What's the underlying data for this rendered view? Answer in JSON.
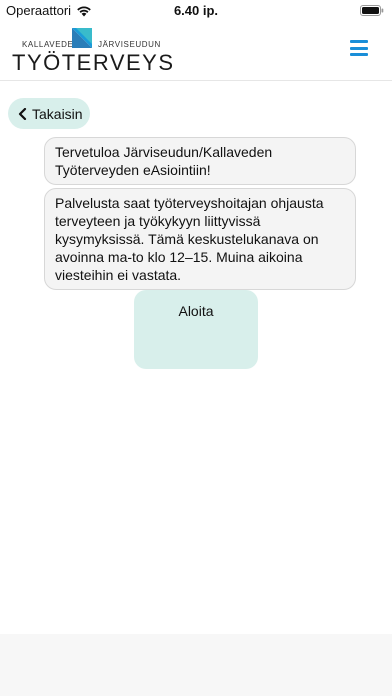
{
  "status_bar": {
    "carrier": "Operaattori",
    "time": "6.40 ip."
  },
  "header": {
    "logo_left": "KALLAVEDEN",
    "logo_right": "JÄRVISEUDUN",
    "logo_main": "TYÖTERVEYS",
    "brand_color": "#1a8ed8"
  },
  "nav": {
    "back_label": "Takaisin"
  },
  "chat": {
    "messages": [
      "Tervetuloa Järviseudun/Kallaveden Työterveyden eAsiointiin!",
      "Palvelusta saat työterveyshoitajan ohjausta terveyteen ja työkykyyn liittyvissä kysymyksissä. Tämä keskustelukanava on avoinna ma-to klo 12–15. Muina aikoina viesteihin ei vastata."
    ],
    "start_label": "Aloita"
  },
  "colors": {
    "accent_light": "#d8efeb",
    "bubble_bg": "#f4f4f4"
  }
}
